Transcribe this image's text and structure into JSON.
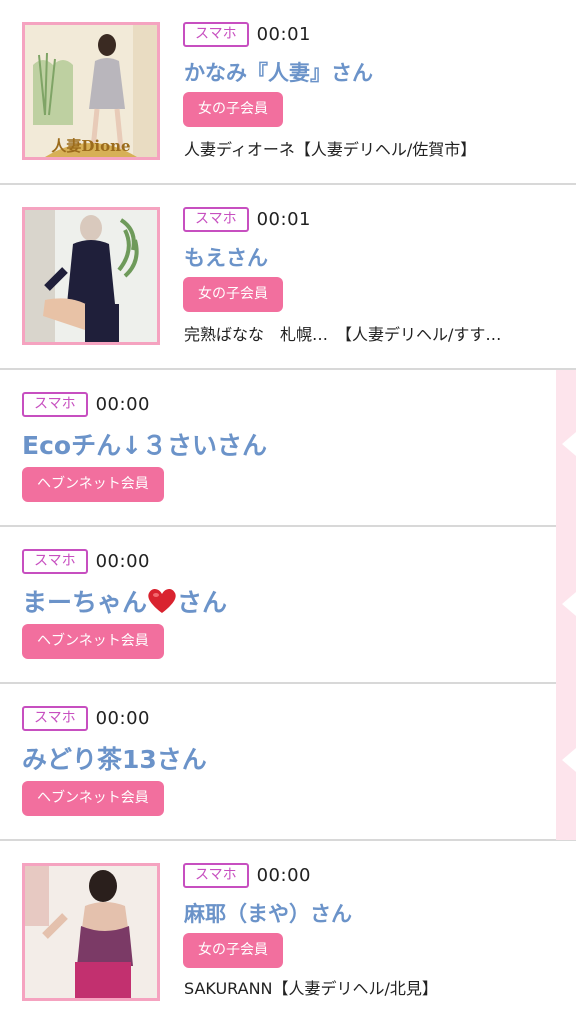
{
  "items": [
    {
      "badge": "スマホ",
      "time": "00:01",
      "name": "かなみ『人妻』さん",
      "member": "女の子会員",
      "shop": "人妻ディオーネ【人妻デリヘル/佐賀市】",
      "thumb_logo": "人妻Dione"
    },
    {
      "badge": "スマホ",
      "time": "00:01",
      "name": "もえさん",
      "member": "女の子会員",
      "shop": "完熟ばなな　札幌…　【人妻デリヘル/すす…"
    },
    {
      "badge": "スマホ",
      "time": "00:00",
      "name": "Ecoチん↓３さいさん",
      "member": "ヘブンネット会員"
    },
    {
      "badge": "スマホ",
      "time": "00:00",
      "name_before": "まーちゃん",
      "name_icon": "heart-icon",
      "name_after": "さん",
      "member": "ヘブンネット会員"
    },
    {
      "badge": "スマホ",
      "time": "00:00",
      "name": "みどり茶13さん",
      "member": "ヘブンネット会員"
    },
    {
      "badge": "スマホ",
      "time": "00:00",
      "name": "麻耶（まや）さん",
      "member": "女の子会員",
      "shop": "SAKURANN【人妻デリヘル/北見】"
    }
  ],
  "colors": {
    "badge": "#c74fc0",
    "name": "#6b93c9",
    "member_bg": "#f26f9e",
    "thumb_border": "#f5a3c0",
    "side_accent": "#fde4ec"
  }
}
